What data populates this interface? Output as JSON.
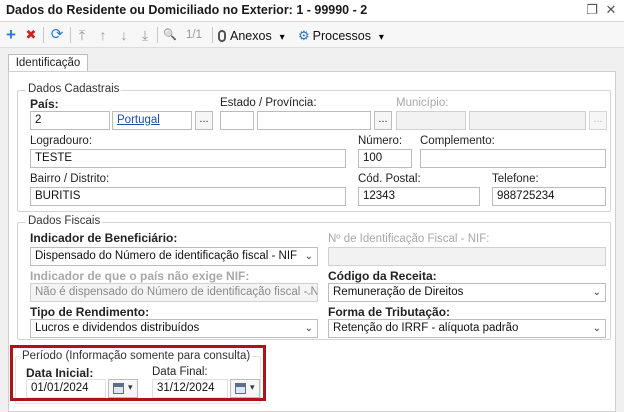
{
  "window": {
    "title": "Dados do Residente ou Domiciliado no Exterior: 1 - 99990 - 2",
    "restore_glyph": "❐",
    "close_glyph": "✕"
  },
  "toolbar": {
    "add_icon": "+",
    "delete_icon": "✖",
    "refresh_icon": "⟳",
    "first_icon": "⤒",
    "prev_icon": "↑",
    "next_icon": "↓",
    "last_icon": "⤓",
    "search_icon": "🔍",
    "page_counter": "1/1",
    "attachments_label": "Anexos",
    "processes_label": "Processos",
    "dropdown_glyph": "▾"
  },
  "tabs": [
    {
      "label": "Identificação"
    }
  ],
  "dados_cadastrais": {
    "title": "Dados Cadastrais",
    "pais": {
      "label": "País:",
      "code": "2",
      "name": "Portugal"
    },
    "estado": {
      "label": "Estado / Província:",
      "code": "",
      "name": ""
    },
    "municipio": {
      "label": "Município:",
      "code": "",
      "name": ""
    },
    "logradouro": {
      "label": "Logradouro:",
      "value": "TESTE"
    },
    "numero": {
      "label": "Número:",
      "value": "100"
    },
    "complemento": {
      "label": "Complemento:",
      "value": ""
    },
    "bairro": {
      "label": "Bairro / Distrito:",
      "value": "BURITIS"
    },
    "cep": {
      "label": "Cód. Postal:",
      "value": "12343"
    },
    "telefone": {
      "label": "Telefone:",
      "value": "988725234"
    },
    "lookup_glyph": "..."
  },
  "dados_fiscais": {
    "title": "Dados Fiscais",
    "indicador_beneficiario": {
      "label": "Indicador de Beneficiário:",
      "value": "Dispensado do Número de identificação fiscal - NIF"
    },
    "nif": {
      "label": "Nº de Identificação Fiscal - NIF:",
      "value": ""
    },
    "indicador_nao_exige": {
      "label": "Indicador de que o país não exige NIF:",
      "value": "Não é dispensado do Número de identificação fiscal - NIF"
    },
    "codigo_receita": {
      "label": "Código da Receita:",
      "value": "Remuneração de Direitos"
    },
    "tipo_rendimento": {
      "label": "Tipo de Rendimento:",
      "value": "Lucros e dividendos distribuídos"
    },
    "forma_tributacao": {
      "label": "Forma de Tributação:",
      "value": "Retenção do IRRF - alíquota padrão"
    },
    "select_glyph": "⌄"
  },
  "periodo": {
    "title": "Período (Informação somente para consulta)",
    "data_inicial": {
      "label": "Data Inicial:",
      "value": "01/01/2024"
    },
    "data_final": {
      "label": "Data Final:",
      "value": "31/12/2024"
    }
  },
  "colors": {
    "highlight": "#b0121a",
    "add_icon": "#2a7bd4",
    "delete_icon": "#d02020",
    "link": "#1a4fb0"
  }
}
